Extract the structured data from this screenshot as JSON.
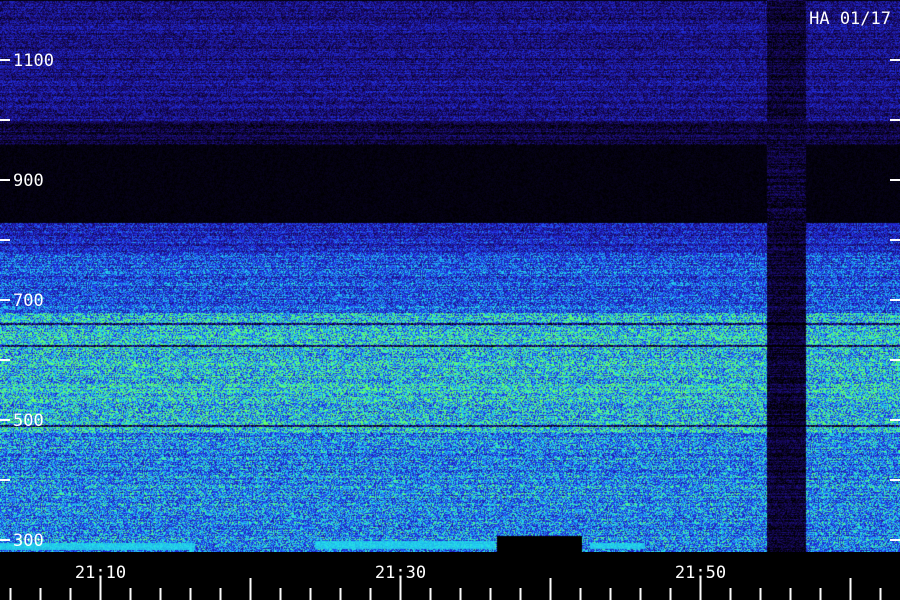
{
  "chart_data": {
    "type": "heatmap",
    "station_label": "HA 01/17",
    "y_axis": {
      "range": [
        280,
        1200
      ],
      "labeled_ticks": [
        {
          "value": 1100,
          "label": "1100"
        },
        {
          "value": 900,
          "label": "900"
        },
        {
          "value": 700,
          "label": "700"
        },
        {
          "value": 500,
          "label": "500"
        },
        {
          "value": 300,
          "label": "300"
        }
      ],
      "unlabeled_ticks": [
        1000,
        800,
        600,
        400
      ]
    },
    "x_axis": {
      "range_minutes": [
        1263.3,
        1323.3
      ],
      "labeled_ticks": [
        {
          "minute": 1270,
          "label": "21:10"
        },
        {
          "minute": 1290,
          "label": "21:30"
        },
        {
          "minute": 1310,
          "label": "21:50"
        }
      ],
      "minor_tick_interval_minutes": 2,
      "major_tick_interval_minutes": 10
    },
    "intensity_bands": [
      {
        "from": 1000,
        "to": 1200,
        "level": 0.3
      },
      {
        "from": 960,
        "to": 1000,
        "level": 0.14
      },
      {
        "from": 830,
        "to": 960,
        "level": 0.05
      },
      {
        "from": 780,
        "to": 830,
        "level": 0.45
      },
      {
        "from": 680,
        "to": 780,
        "level": 0.58
      },
      {
        "from": 480,
        "to": 680,
        "level": 0.82
      },
      {
        "from": 280,
        "to": 480,
        "level": 0.68
      }
    ],
    "dropout": {
      "minute_start": 1314.4,
      "minute_end": 1317.0,
      "level": 0.12
    },
    "colors": {
      "background": "#000000",
      "low": "#1a0a6b",
      "mid": "#2233ee",
      "high": "#22ddee",
      "peak": "#66ff66",
      "axis": "#ffffff"
    }
  }
}
